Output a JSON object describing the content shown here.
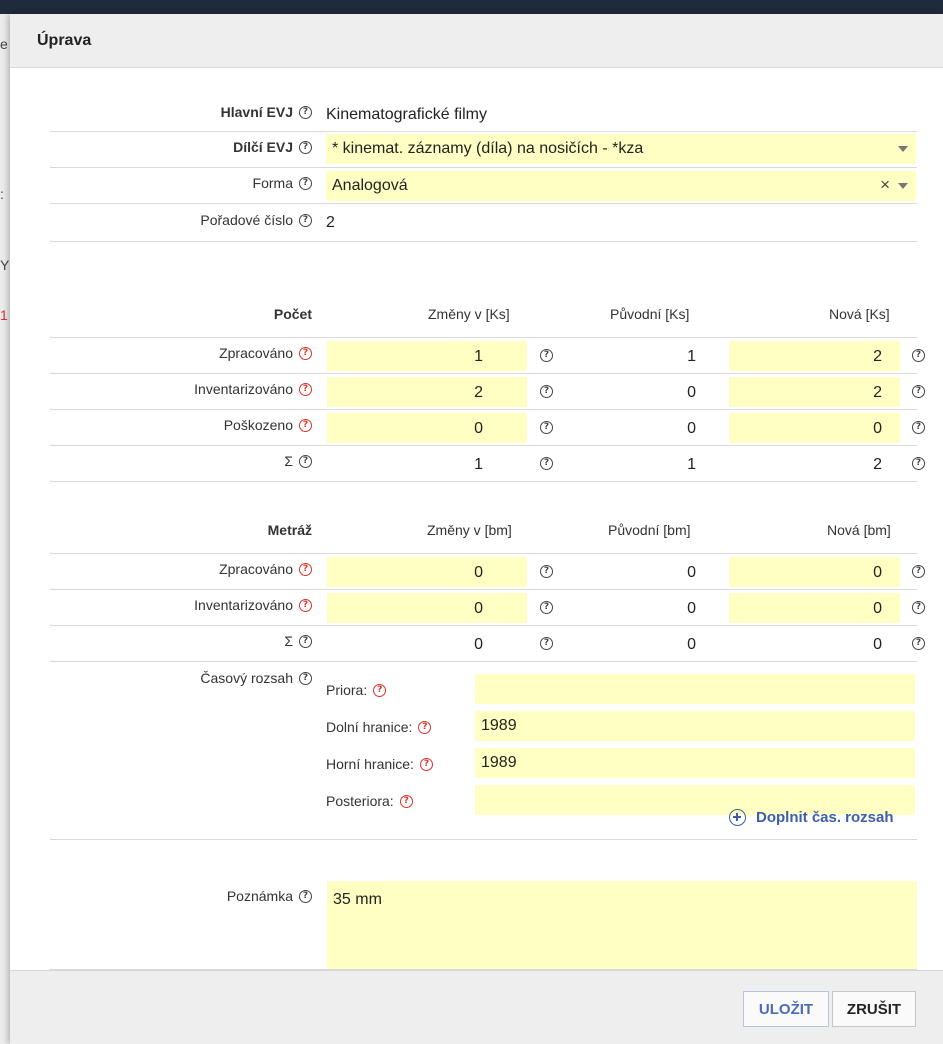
{
  "dialog": {
    "title": "Úprava"
  },
  "background": {
    "left_chars": [
      "e",
      ":",
      "Y",
      "1"
    ]
  },
  "fields": {
    "hlavni_evj": {
      "label": "Hlavní EVJ",
      "value": "Kinematografické filmy"
    },
    "dilci_evj": {
      "label": "Dílčí EVJ",
      "value": "* kinemat. záznamy (díla) na nosičích - *kza"
    },
    "forma": {
      "label": "Forma",
      "value": "Analogová",
      "clear": "×"
    },
    "poradove_cislo": {
      "label": "Pořadové číslo",
      "value": "2"
    }
  },
  "pocet": {
    "title": "Počet",
    "col_changes": "Změny v [Ks]",
    "col_original": "Původní [Ks]",
    "col_new": "Nová [Ks]",
    "rows": [
      {
        "label": "Zpracováno",
        "change": "1",
        "original": "1",
        "new": "2"
      },
      {
        "label": "Inventarizováno",
        "change": "2",
        "original": "0",
        "new": "2"
      },
      {
        "label": "Poškozeno",
        "change": "0",
        "original": "0",
        "new": "0"
      }
    ],
    "sum": {
      "label": "Σ",
      "change": "1",
      "original": "1",
      "new": "2"
    }
  },
  "metraz": {
    "title": "Metráž",
    "col_changes": "Změny v [bm]",
    "col_original": "Původní [bm]",
    "col_new": "Nová [bm]",
    "rows": [
      {
        "label": "Zpracováno",
        "change": "0",
        "original": "0",
        "new": "0"
      },
      {
        "label": "Inventarizováno",
        "change": "0",
        "original": "0",
        "new": "0"
      }
    ],
    "sum": {
      "label": "Σ",
      "change": "0",
      "original": "0",
      "new": "0"
    }
  },
  "casovy_rozsah": {
    "label": "Časový rozsah",
    "priora": {
      "label": "Priora:",
      "value": ""
    },
    "dolni": {
      "label": "Dolní hranice:",
      "value": "1989"
    },
    "horni": {
      "label": "Horní hranice:",
      "value": "1989"
    },
    "posteriora": {
      "label": "Posteriora:",
      "value": ""
    },
    "add_label": "Doplnit čas. rozsah"
  },
  "poznamka": {
    "label": "Poznámka",
    "value": "35 mm"
  },
  "footer": {
    "save": "ULOŽIT",
    "cancel": "ZRUŠIT"
  },
  "colors": {
    "input_bg": "#ffffc4",
    "accent": "#3e5ea8",
    "help_red": "#d9342b"
  }
}
